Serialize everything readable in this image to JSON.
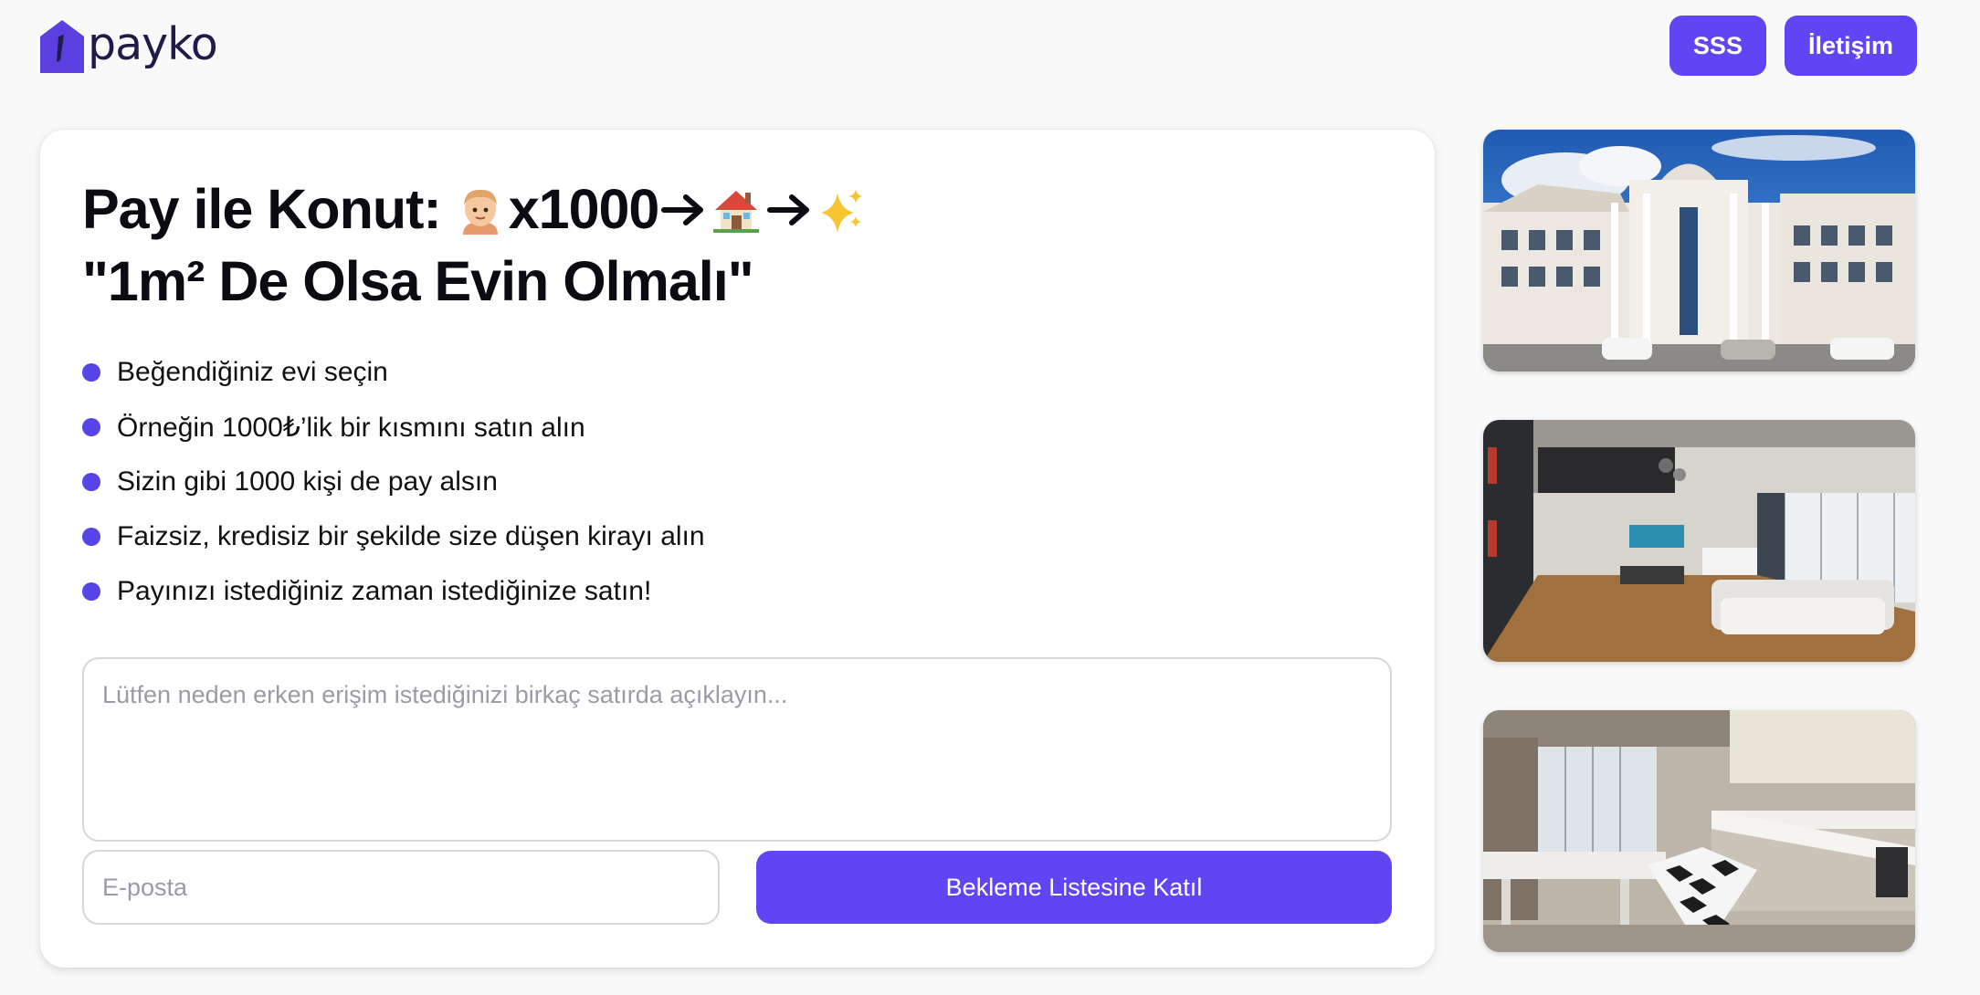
{
  "header": {
    "brand": "payko",
    "nav": [
      {
        "label": "SSS"
      },
      {
        "label": "İletişim"
      }
    ]
  },
  "hero": {
    "headline_prefix": "Pay ile Konut:",
    "headline_multiplier": "x1000",
    "headline_emojis": [
      "man-emoji",
      "house-emoji",
      "sparkles-emoji"
    ],
    "headline_line2": "\"1m² De Olsa Evin Olmalı\""
  },
  "bullets": [
    {
      "text": "Beğendiğiniz evi seçin"
    },
    {
      "text": "Örneğin 1000₺’lik bir kısmını satın alın"
    },
    {
      "text": "Sizin gibi 1000 kişi de pay alsın"
    },
    {
      "text": "Faizsiz, kredisiz bir şekilde size düşen kirayı alın"
    },
    {
      "text": "Payınızı istediğiniz zaman istediğinize satın!"
    }
  ],
  "form": {
    "reason_placeholder": "Lütfen neden erken erişim istediğinizi birkaç satırda açıklayın...",
    "reason_value": "",
    "email_placeholder": "E-posta",
    "email_value": "",
    "submit_label": "Bekleme Listesine Katıl"
  },
  "photos": [
    {
      "subject": "apartment-building-exterior"
    },
    {
      "subject": "living-room-interior"
    },
    {
      "subject": "kitchen-interior"
    }
  ],
  "colors": {
    "accent": "#6145f5",
    "bullet": "#5644e6",
    "brand_text": "#1f1b4a",
    "background": "#f9f9fa"
  }
}
